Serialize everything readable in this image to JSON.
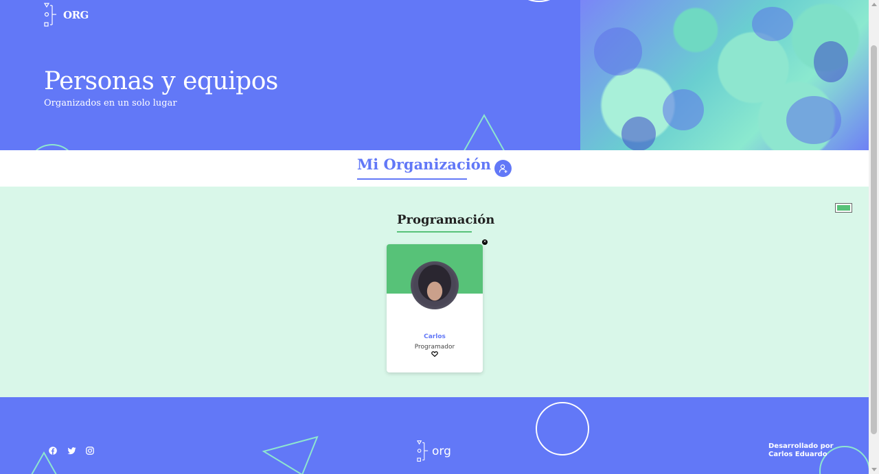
{
  "header": {
    "logo_text": "ORG",
    "title": "Personas y equipos",
    "subtitle": "Organizados en un solo lugar"
  },
  "nav": {
    "title": "Mi Organización",
    "add_icon": "user-plus-icon"
  },
  "team": {
    "title": "Programación",
    "color": "#57c278",
    "members": [
      {
        "name": "Carlos",
        "role": "Programador"
      }
    ]
  },
  "footer": {
    "social": [
      "facebook-icon",
      "twitter-icon",
      "instagram-icon"
    ],
    "logo_text": "org",
    "credit_line1": "Desarrollado por",
    "credit_line2": "Carlos Eduardo"
  },
  "colors": {
    "primary": "#6278f7",
    "team_bg": "#d9f7e9",
    "team_accent": "#57c278"
  }
}
